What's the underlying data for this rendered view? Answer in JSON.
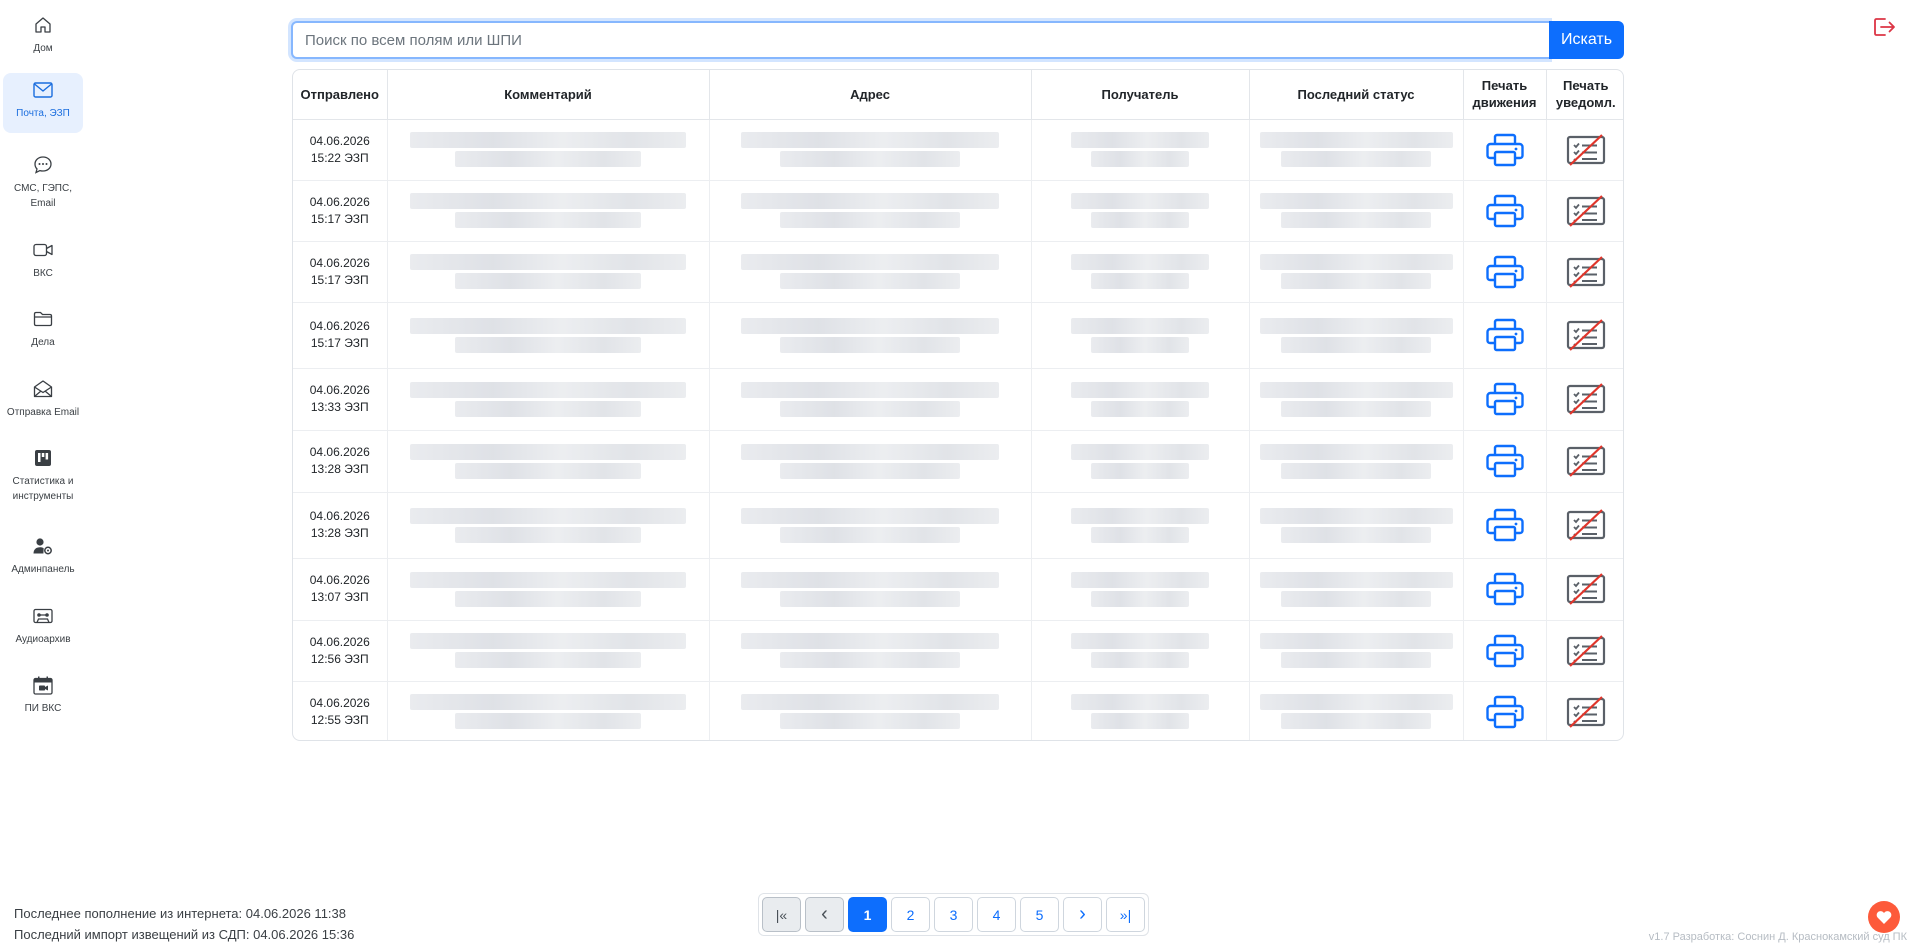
{
  "sidebar": {
    "items": [
      {
        "label": "Дом",
        "icon": "home-icon"
      },
      {
        "label": "Почта, ЭЗП",
        "icon": "envelope-icon",
        "active": true
      },
      {
        "label": "СМС, ГЭПС, Email",
        "icon": "chat-bubble-icon"
      },
      {
        "label": "ВКС",
        "icon": "camera-icon"
      },
      {
        "label": "Дела",
        "icon": "folder-icon"
      },
      {
        "label": "Отправка Email",
        "icon": "envelope-open-icon"
      },
      {
        "label": "Статистика и инструменты",
        "icon": "kanban-icon"
      },
      {
        "label": "Админпанель",
        "icon": "user-gear-icon"
      },
      {
        "label": "Аудиоархив",
        "icon": "cassette-icon"
      },
      {
        "label": "ПИ ВКС",
        "icon": "calendar-video-icon"
      }
    ]
  },
  "search": {
    "placeholder": "Поиск по всем полям или ШПИ",
    "button_label": "Искать"
  },
  "table": {
    "headers": {
      "sent": "Отправлено",
      "comment": "Комментарий",
      "address": "Адрес",
      "recipient": "Получатель",
      "last_status": "Последний статус",
      "print_movement": "Печать движения",
      "print_notice": "Печать уведомл."
    },
    "rows": [
      {
        "date": "04.06.2026",
        "time": "15:22 ЭЗП"
      },
      {
        "date": "04.06.2026",
        "time": "15:17 ЭЗП"
      },
      {
        "date": "04.06.2026",
        "time": "15:17 ЭЗП"
      },
      {
        "date": "04.06.2026",
        "time": "15:17 ЭЗП"
      },
      {
        "date": "04.06.2026",
        "time": "13:33 ЭЗП"
      },
      {
        "date": "04.06.2026",
        "time": "13:28 ЭЗП"
      },
      {
        "date": "04.06.2026",
        "time": "13:28 ЭЗП"
      },
      {
        "date": "04.06.2026",
        "time": "13:07 ЭЗП"
      },
      {
        "date": "04.06.2026",
        "time": "12:56 ЭЗП"
      },
      {
        "date": "04.06.2026",
        "time": "12:55 ЭЗП"
      }
    ]
  },
  "footer": {
    "last_refill": "Последнее пополнение из интернета: 04.06.2026 11:38",
    "last_import": "Последний импорт извещений из СДП: 04.06.2026 15:36",
    "version": "v1.7 Разработка: Соснин Д. Краснокамский суд ПК"
  },
  "pagination": {
    "first": "|«",
    "prev": "‹",
    "pages": [
      "1",
      "2",
      "3",
      "4",
      "5"
    ],
    "current": "1",
    "next": "›",
    "last": "»|"
  },
  "colors": {
    "accent": "#0d6efd",
    "logout": "#dc3545",
    "heart": "#fd5a3a"
  }
}
